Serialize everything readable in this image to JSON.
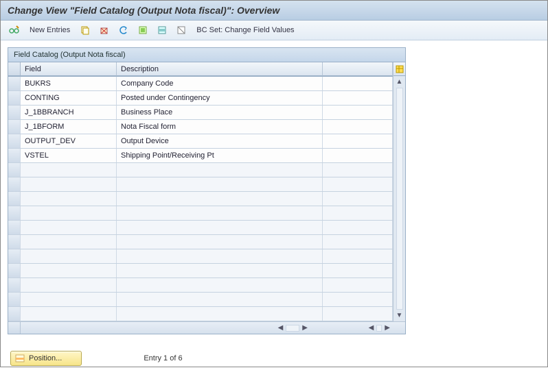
{
  "title": "Change View \"Field Catalog (Output Nota fiscal)\": Overview",
  "toolbar": {
    "new_entries": "New Entries",
    "bc_set": "BC Set: Change Field Values"
  },
  "panel": {
    "title": "Field Catalog (Output Nota fiscal)",
    "columns": {
      "field": "Field",
      "description": "Description"
    },
    "rows": [
      {
        "field": "BUKRS",
        "description": "Company Code"
      },
      {
        "field": "CONTING",
        "description": "Posted under Contingency"
      },
      {
        "field": "J_1BBRANCH",
        "description": "Business Place"
      },
      {
        "field": "J_1BFORM",
        "description": "Nota Fiscal form"
      },
      {
        "field": "OUTPUT_DEV",
        "description": "Output Device"
      },
      {
        "field": "VSTEL",
        "description": "Shipping Point/Receiving Pt"
      }
    ],
    "empty_rows": 11
  },
  "footer": {
    "position_label": "Position...",
    "entry_label": "Entry 1 of 6"
  }
}
